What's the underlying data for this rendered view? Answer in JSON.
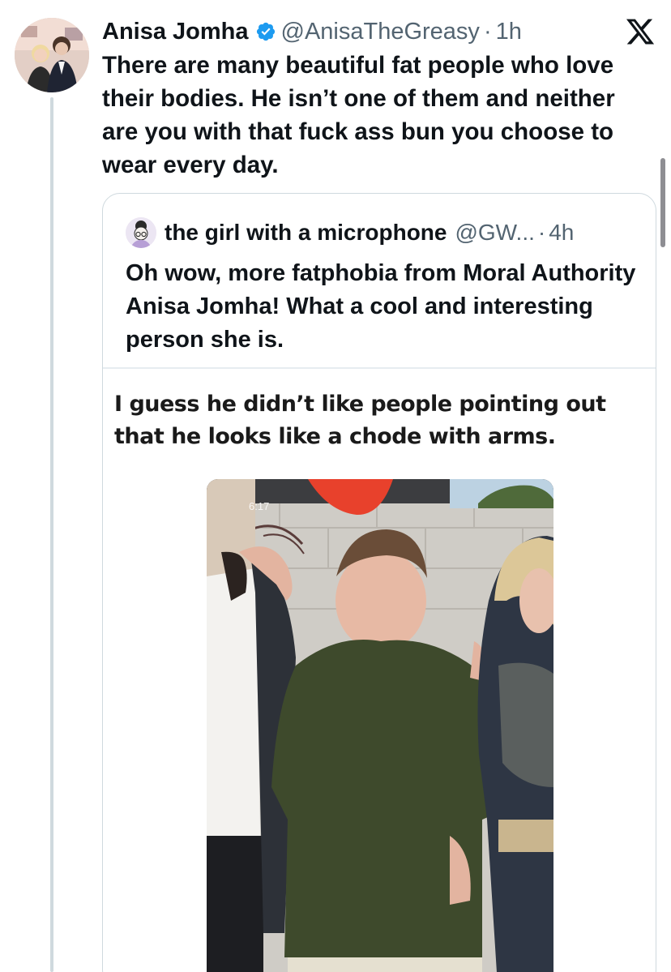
{
  "tweet": {
    "author": {
      "display_name": "Anisa Jomha",
      "handle": "@AnisaTheGreasy",
      "verified": true
    },
    "separator": "·",
    "time": "1h",
    "text": "There are many beautiful fat people who love their bodies. He isn’t one of them and neither are you with that fuck ass bun you choose to wear every day."
  },
  "quoted_tweet": {
    "author": {
      "display_name": "the girl with a microphone",
      "handle": "@GW..."
    },
    "separator": "·",
    "time": "4h",
    "text": "Oh wow, more fatphobia from Moral Authority Anisa Jomha! What a cool and interesting person she is.",
    "embedded_caption": "I guess he didn’t like people pointing out that he looks like a chode with arms.",
    "embedded_photo_status_time": "6:17"
  },
  "icons": {
    "verified": "verified-badge-icon",
    "x_logo": "x-logo-icon"
  },
  "colors": {
    "verified_blue": "#1d9bf0",
    "secondary_text": "#536471",
    "border": "#cfd9de"
  }
}
